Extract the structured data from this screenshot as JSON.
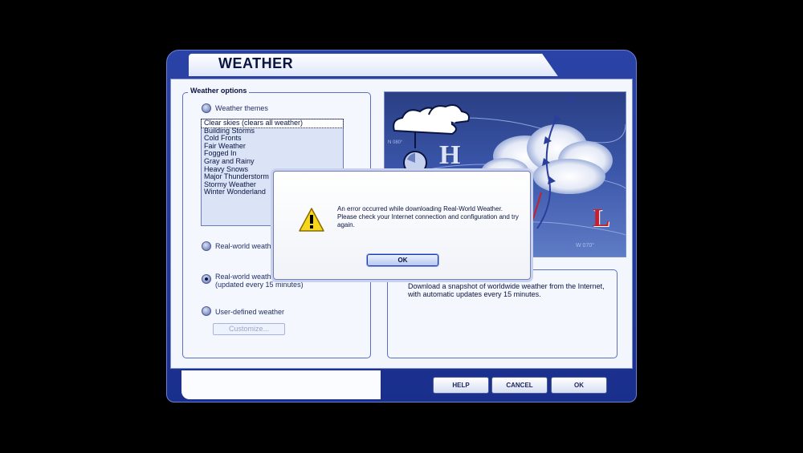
{
  "window": {
    "title": "WEATHER"
  },
  "weather_options": {
    "legend": "Weather options",
    "themes_label": "Weather themes",
    "themes": [
      "Clear skies (clears all weather)",
      "Building Storms",
      "Cold Fronts",
      "Fair Weather",
      "Fogged In",
      "Gray and Rainy",
      "Heavy Snows",
      "Major Thunderstorm",
      "Stormy Weather",
      "Winter Wonderland"
    ],
    "realworld_static_label": "Real-world weath",
    "realworld_update_label_1": "Real-world weath",
    "realworld_update_label_2": "(updated every 15 minutes)",
    "user_defined_label": "User-defined weather",
    "customize_label": "Customize..."
  },
  "weather_image": {
    "high_letter": "H",
    "low_letter": "L",
    "heading_left": "N 080°",
    "heading_right": "W 070°"
  },
  "description": "Download a snapshot of worldwide weather from the Internet, with automatic updates every 15 minutes.",
  "buttons": {
    "help": "HELP",
    "cancel": "CANCEL",
    "ok": "OK"
  },
  "error_dialog": {
    "message": "An error occurred while downloading Real-World Weather. Please check your Internet connection and configuration and try again.",
    "ok": "OK"
  },
  "colors": {
    "window_frame": "#1a2f8c",
    "panel": "#f3f6fd",
    "dialog_border": "#1f3aa6"
  }
}
